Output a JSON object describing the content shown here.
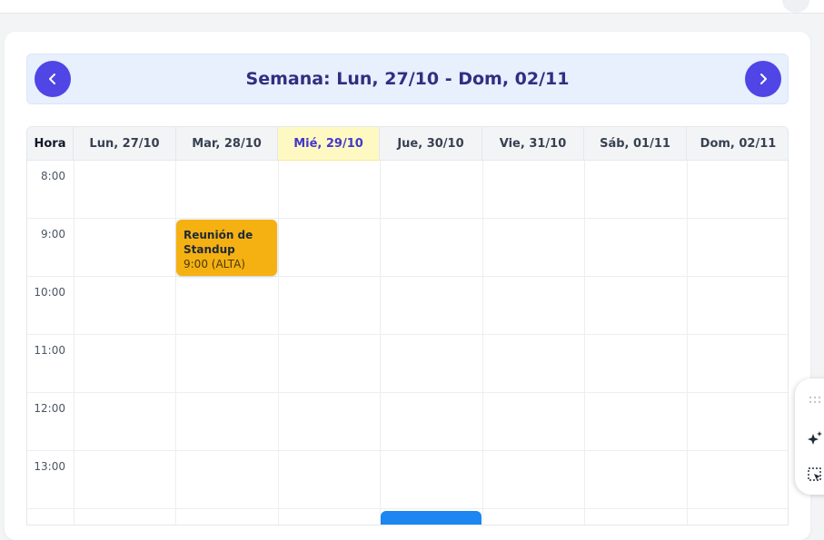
{
  "header": {
    "title": "Semana: Lun, 27/10 - Dom, 02/11",
    "prev_icon": "chevron-left-icon",
    "next_icon": "chevron-right-icon",
    "accent_color": "#4f46e5"
  },
  "calendar": {
    "hour_column_label": "Hora",
    "days": [
      {
        "label": "Lun, 27/10"
      },
      {
        "label": "Mar, 28/10"
      },
      {
        "label": "Mié, 29/10",
        "today": true
      },
      {
        "label": "Jue, 30/10"
      },
      {
        "label": "Vie, 31/10"
      },
      {
        "label": "Sáb, 01/11"
      },
      {
        "label": "Dom, 02/11"
      }
    ],
    "hours": [
      "8:00",
      "9:00",
      "10:00",
      "11:00",
      "12:00",
      "13:00"
    ],
    "events": [
      {
        "title": "Reunión de Standup",
        "meta": "9:00 (ALTA)",
        "day": "Mar, 28/10",
        "color": "#f5b112"
      },
      {
        "day": "Jue, 30/10",
        "color": "#1d86f0"
      }
    ]
  },
  "floating_toolbar": {
    "icons": [
      "drag-handle-icon",
      "sparkle-icon",
      "select-region-icon"
    ]
  }
}
